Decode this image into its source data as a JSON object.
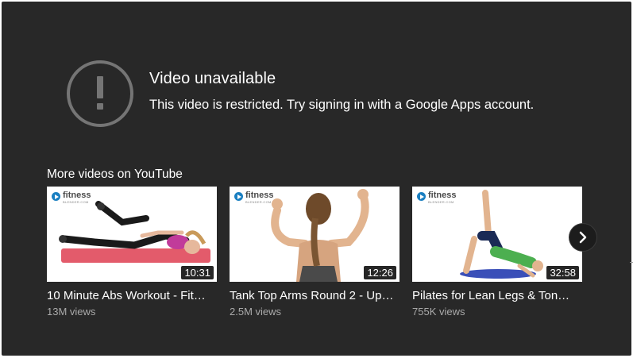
{
  "error": {
    "title": "Video unavailable",
    "message": "This video is restricted. Try signing in with a Google Apps account.",
    "icon": "alert-circle-icon"
  },
  "more": {
    "heading": "More videos on YouTube",
    "brand_name": "fitness",
    "brand_sub": "BLENDER.COM",
    "videos": [
      {
        "title": "10 Minute Abs Workout - Fit…",
        "views": "13M views",
        "duration": "10:31"
      },
      {
        "title": "Tank Top Arms Round 2 - Up…",
        "views": "2.5M views",
        "duration": "12:26"
      },
      {
        "title": "Pilates for Lean Legs & Ton…",
        "views": "755K views",
        "duration": "32:58"
      }
    ],
    "next_icon": "chevron-right-icon"
  }
}
